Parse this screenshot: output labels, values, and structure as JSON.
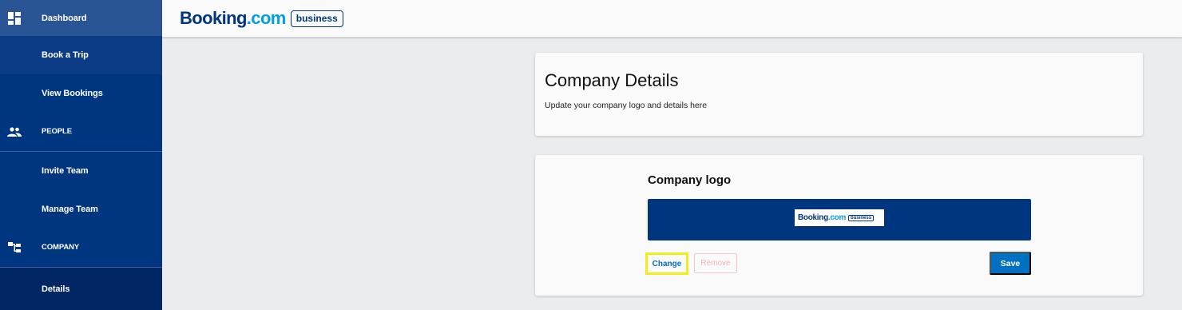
{
  "sidebar": {
    "items": [
      {
        "label": "Dashboard",
        "icon": "dashboard-icon"
      },
      {
        "label": "Book a Trip"
      },
      {
        "label": "View Bookings"
      },
      {
        "label": "PEOPLE",
        "icon": "people-icon"
      },
      {
        "label": "Invite Team"
      },
      {
        "label": "Manage Team"
      },
      {
        "label": "COMPANY",
        "icon": "company-icon"
      },
      {
        "label": "Details"
      }
    ]
  },
  "header": {
    "brand_part1": "Booking",
    "brand_part2": ".com",
    "brand_badge": "business"
  },
  "company_details": {
    "title": "Company Details",
    "subtitle": "Update your company logo and details here"
  },
  "company_logo": {
    "heading": "Company logo",
    "change_label": "Change",
    "remove_label": "Remove",
    "save_label": "Save"
  },
  "colors": {
    "sidebar_bg": "#003580",
    "accent": "#0071c2",
    "brand_light": "#009fe3",
    "highlight": "#f1ec1a"
  }
}
